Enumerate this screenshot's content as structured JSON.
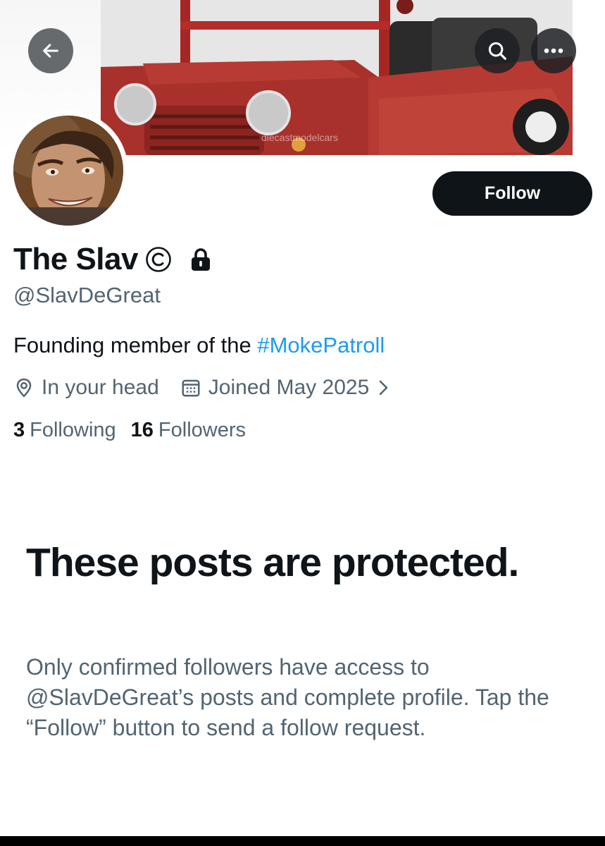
{
  "header": {
    "back_icon": "arrow-left-icon",
    "search_icon": "search-icon",
    "more_icon": "more-horizontal-icon",
    "banner_watermark": "diecastmodelcars"
  },
  "profile": {
    "follow_label": "Follow",
    "display_name": "The Slav",
    "name_badge_icon": "circled-c-icon",
    "lock_icon": "lock-icon",
    "handle": "@SlavDeGreat",
    "bio_text": "Founding member of the ",
    "bio_hashtag": "#MokePatroll",
    "location": "In your head",
    "location_icon": "location-pin-icon",
    "joined": "Joined May 2025",
    "joined_icon": "calendar-icon",
    "following_count": "3",
    "following_label": "Following",
    "followers_count": "16",
    "followers_label": "Followers"
  },
  "protected": {
    "title": "These posts are protected.",
    "body": "Only confirmed followers have access to @SlavDeGreat’s posts and complete profile. Tap the “Follow” button to send a follow request."
  },
  "colors": {
    "text": "#0f1419",
    "secondary": "#536471",
    "link": "#1d9bf0",
    "button_bg": "#0f1419"
  }
}
